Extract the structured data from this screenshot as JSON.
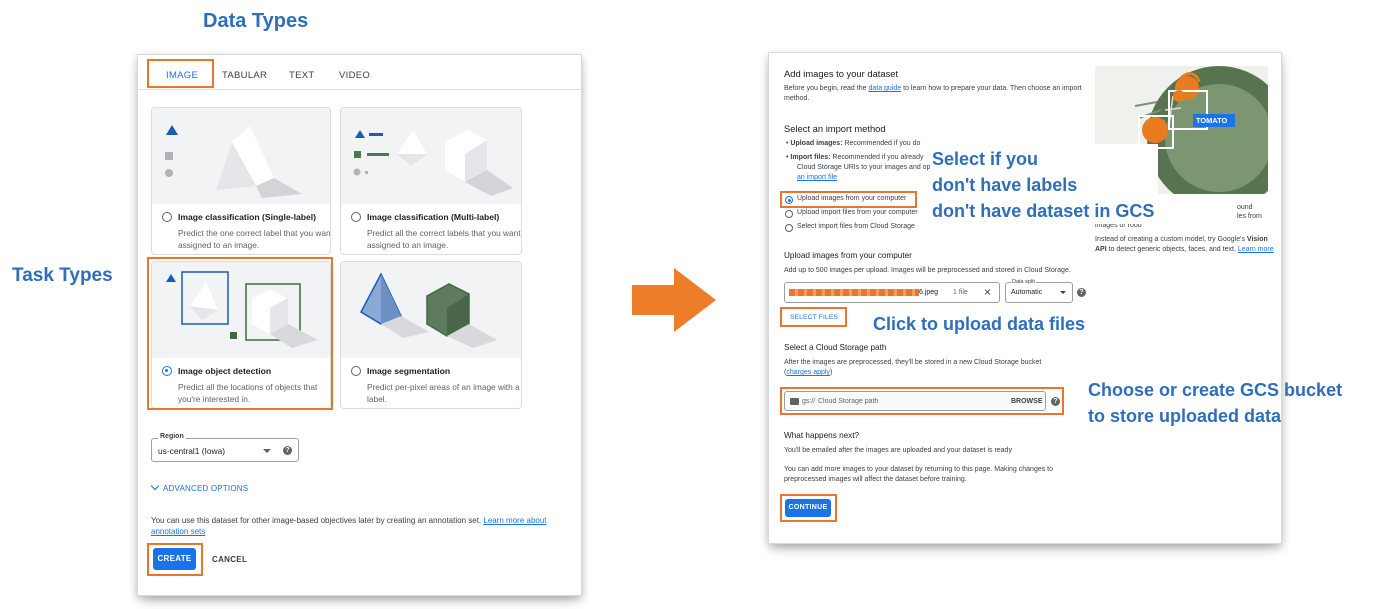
{
  "callouts": {
    "data_types": "Data Types",
    "task_types": "Task Types",
    "select_note_line1": "Select if you",
    "select_note_line2": "don't have labels",
    "select_note_line3": "don't have dataset in GCS",
    "upload_note": "Click to upload data files",
    "bucket_note_line1": "Choose or create GCS bucket",
    "bucket_note_line2": "to store uploaded data"
  },
  "left": {
    "tabs": [
      "IMAGE",
      "TABULAR",
      "TEXT",
      "VIDEO"
    ],
    "active_tab": "IMAGE",
    "cards": [
      {
        "title": "Image classification (Single-label)",
        "desc": "Predict the one correct label that you want assigned to an image.",
        "selected": false
      },
      {
        "title": "Image classification (Multi-label)",
        "desc": "Predict all the correct labels that you want assigned to an image.",
        "selected": false
      },
      {
        "title": "Image object detection",
        "desc": "Predict all the locations of objects that you're interested in.",
        "selected": true
      },
      {
        "title": "Image segmentation",
        "desc": "Predict per-pixel areas of an image with a label.",
        "selected": false
      }
    ],
    "region_label": "Region",
    "region_value": "us-central1 (Iowa)",
    "advanced_options": "ADVANCED OPTIONS",
    "annotation_text": "You can use this dataset for other image-based objectives later by creating an annotation set.",
    "annotation_link": "Learn more about annotation sets",
    "create_button": "CREATE",
    "cancel_button": "CANCEL"
  },
  "right": {
    "title": "Add images to your dataset",
    "intro_pre": "Before you begin, read the",
    "intro_link": "data guide",
    "intro_post": "to learn how to prepare your data. Then choose an import method.",
    "import_method_heading": "Select an import method",
    "bullet1_bold": "Upload images:",
    "bullet1_text": "Recommended if you do",
    "bullet2_bold": "Import files:",
    "bullet2_text": "Recommended if you already",
    "bullet2_line2": "Cloud Storage URIs to your images and op",
    "bullet2_link": "an import file",
    "options": [
      "Upload images from your computer",
      "Upload import files from your computer",
      "Select import files from Cloud Storage"
    ],
    "selected_option": 0,
    "tomato_label": "TOMATO",
    "side_text1": "ound",
    "side_text2": "les from",
    "side_text3": "images or rooo",
    "side_text4": "Instead of creating a custom model, try Google's",
    "side_vision": "Vision API",
    "side_text5": "to detect generic objects, faces, and text.",
    "side_learn": "Learn more",
    "upload_heading": "Upload images from your computer",
    "upload_desc": "Add up to 500 images per upload. Images will be preprocessed and stored in Cloud Storage.",
    "file_suffix": "6.jpeg",
    "file_count": "1 file",
    "split_label": "Data split",
    "split_value": "Automatic",
    "select_files_button": "SELECT FILES",
    "gcs_heading": "Select a Cloud Storage path",
    "gcs_desc": "After the images are preprocessed, they'll be stored in a new Cloud Storage bucket",
    "gcs_link": "charges apply",
    "gcs_prefix": "gs://",
    "gcs_placeholder": "Cloud Storage path",
    "browse_button": "BROWSE",
    "next_heading": "What happens next?",
    "next_text1": "You'll be emailed after the images are uploaded and your dataset is ready",
    "next_text2": "You can add more images to your dataset by returning to this page. Making changes to preprocessed images will affect the dataset before training.",
    "continue_button": "CONTINUE"
  },
  "colors": {
    "accent": "#1a73e8",
    "highlight": "#e8762d",
    "callout": "#2f6eba",
    "arrow": "#ee7d2a"
  }
}
